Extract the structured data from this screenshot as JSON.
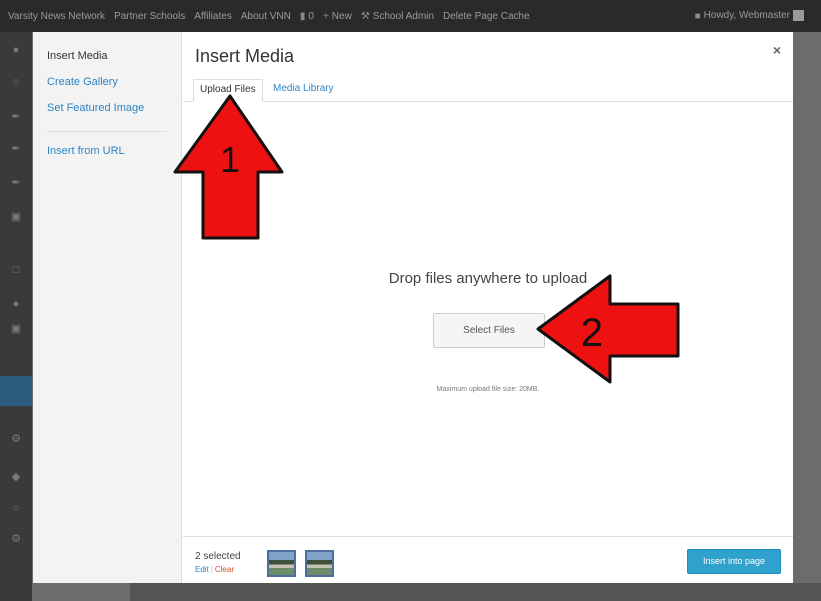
{
  "admin_bar": {
    "items": [
      "Varsity News Network",
      "Partner Schools",
      "Affiliates",
      "About VNN"
    ],
    "comments_count": "0",
    "new_label": "New",
    "school_admin": "School Admin",
    "delete_cache": "Delete Page Cache",
    "howdy": "Howdy, Webmaster"
  },
  "media_menu": {
    "items": [
      {
        "label": "Insert Media",
        "active": true
      },
      {
        "label": "Create Gallery",
        "active": false
      },
      {
        "label": "Set Featured Image",
        "active": false
      }
    ],
    "insert_from_url": "Insert from URL"
  },
  "frame": {
    "title": "Insert Media",
    "close_glyph": "×"
  },
  "tabs": [
    {
      "label": "Upload Files",
      "active": true
    },
    {
      "label": "Media Library",
      "active": false
    }
  ],
  "uploader": {
    "drop_text": "Drop files anywhere to upload",
    "select_button": "Select Files",
    "max_size": "Maximum upload file size: 20MB."
  },
  "toolbar": {
    "selected": "2 selected",
    "edit": "Edit",
    "clear": "Clear",
    "insert_button": "Insert into page"
  },
  "annotations": {
    "arrow1_label": "1",
    "arrow2_label": "2",
    "arrow_color": "#ee1111"
  },
  "colors": {
    "link": "#2e84c4",
    "primary_button": "#2ea2cc",
    "admin_bar": "#2a2a2a",
    "clear_link": "#d54e21"
  }
}
